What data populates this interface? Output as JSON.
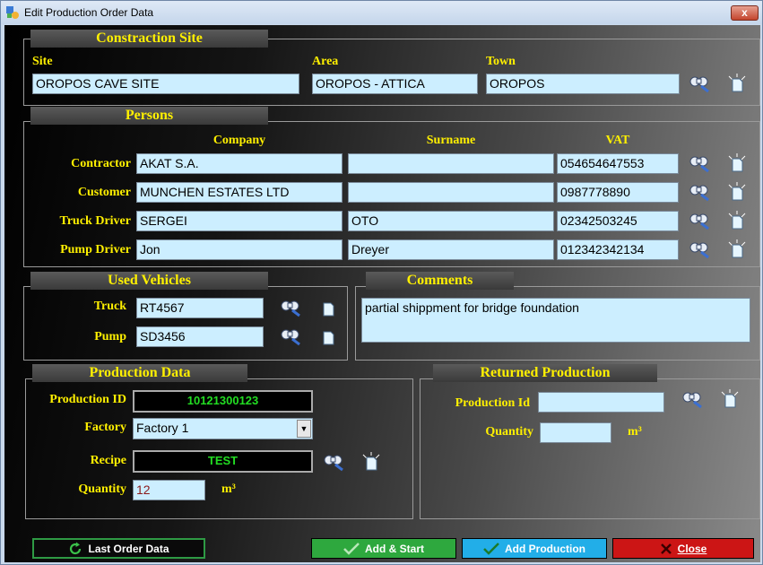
{
  "window": {
    "title": "Edit Production Order Data",
    "close_symbol": "x"
  },
  "site": {
    "title": "Constraction Site",
    "site_label": "Site",
    "site_value": "OROPOS CAVE SITE",
    "area_label": "Area",
    "area_value": "OROPOS - ATTICA",
    "town_label": "Town",
    "town_value": "OROPOS"
  },
  "persons": {
    "title": "Persons",
    "col_company": "Company",
    "col_surname": "Surname",
    "col_vat": "VAT",
    "rows": [
      {
        "label": "Contractor",
        "company": "AKAT S.A.",
        "surname": "",
        "vat": "054654647553"
      },
      {
        "label": "Customer",
        "company": "MUNCHEN ESTATES LTD",
        "surname": "",
        "vat": "0987778890"
      },
      {
        "label": "Truck Driver",
        "company": "SERGEI",
        "surname": "OTO",
        "vat": "02342503245"
      },
      {
        "label": "Pump Driver",
        "company": "Jon",
        "surname": "Dreyer",
        "vat": "012342342134"
      }
    ]
  },
  "vehicles": {
    "title": "Used Vehicles",
    "truck_label": "Truck",
    "truck_value": "RT4567",
    "pump_label": "Pump",
    "pump_value": "SD3456"
  },
  "comments": {
    "title": "Comments",
    "value": "partial shippment for bridge foundation"
  },
  "production": {
    "title": "Production Data",
    "id_label": "Production ID",
    "id_value": "10121300123",
    "factory_label": "Factory",
    "factory_value": "Factory 1",
    "recipe_label": "Recipe",
    "recipe_value": "TEST",
    "quantity_label": "Quantity",
    "quantity_value": "12",
    "unit": "m³"
  },
  "returned": {
    "title": "Returned Production",
    "id_label": "Production Id",
    "id_value": "",
    "quantity_label": "Quantity",
    "quantity_value": "",
    "unit": "m³"
  },
  "buttons": {
    "last_order": "Last Order Data",
    "add_start": "Add & Start",
    "add_production": "Add Production",
    "close": "Close"
  },
  "icons": {
    "search": "search-binoculars-icon",
    "new": "new-document-icon"
  },
  "colors": {
    "label": "#fff000",
    "field": "#cceeff",
    "id_text": "#22dd22",
    "quantity_text": "#8b1a1a"
  }
}
